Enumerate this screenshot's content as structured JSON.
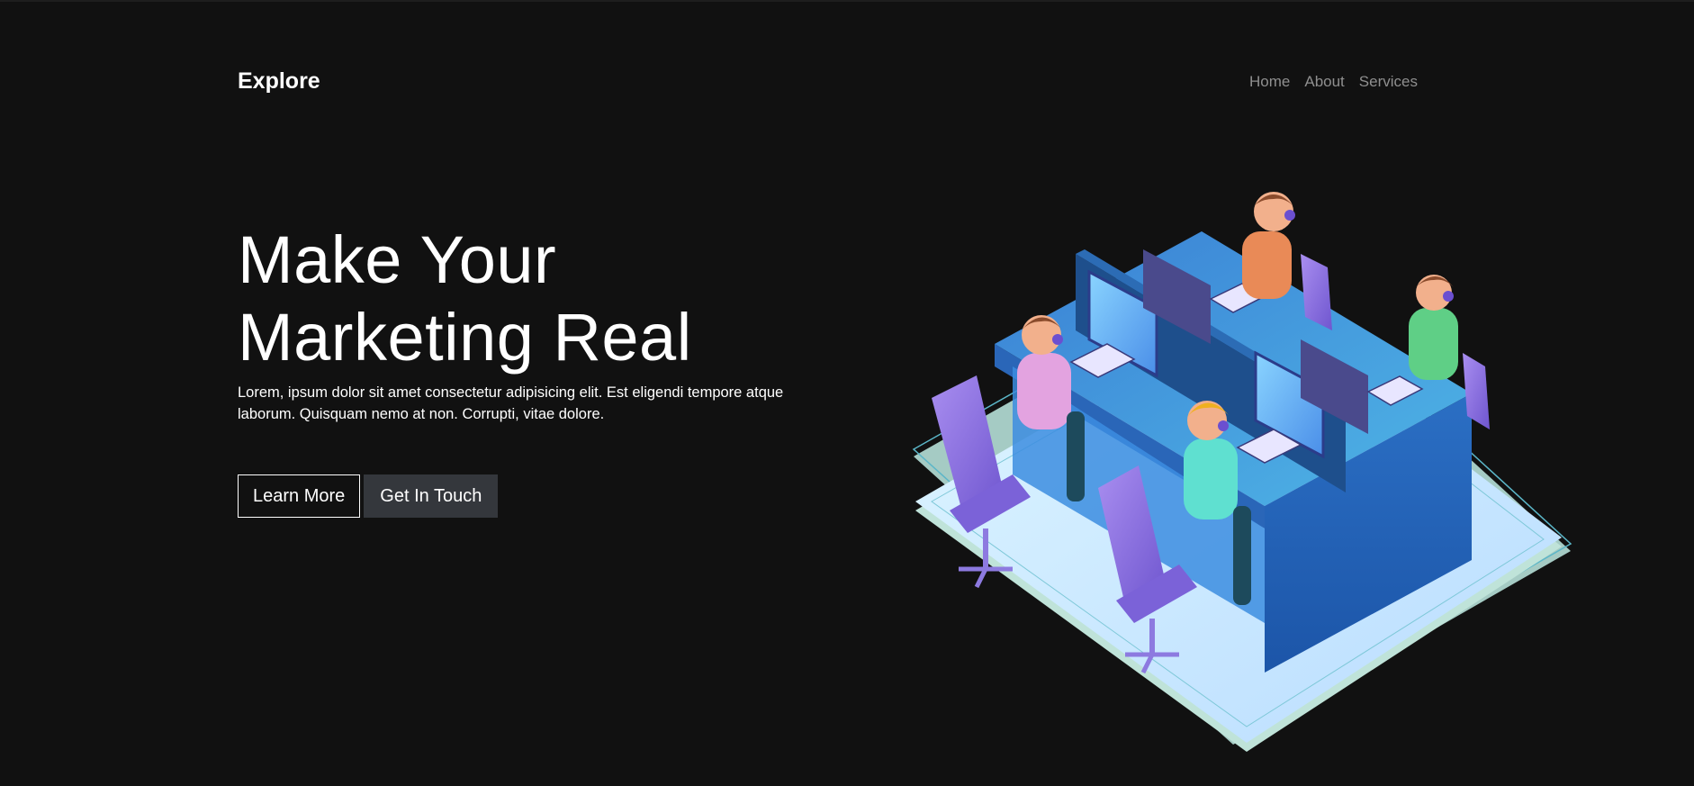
{
  "header": {
    "brand": "Explore",
    "nav": [
      {
        "label": "Home"
      },
      {
        "label": "About"
      },
      {
        "label": "Services"
      }
    ]
  },
  "hero": {
    "title_line1": "Make Your",
    "title_line2": "Marketing Real",
    "description": "Lorem, ipsum dolor sit amet consectetur adipisicing elit. Est eligendi tempore atque laborum. Quisquam nemo at non. Corrupti, vitae dolore.",
    "primary_button": "Learn More",
    "secondary_button": "Get In Touch"
  },
  "colors": {
    "background": "#111111",
    "nav_text": "#8f8f8f",
    "button_dark": "#34373c",
    "illustration_accent": "#3f8fd6"
  },
  "illustration": {
    "icon": "isometric-office-team-illustration"
  }
}
